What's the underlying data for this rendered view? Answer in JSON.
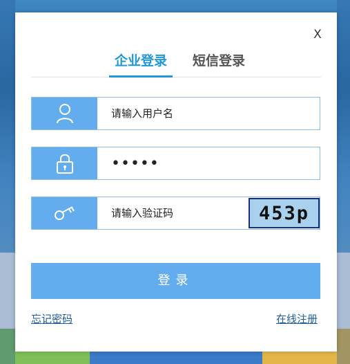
{
  "dialog": {
    "close_label": "X"
  },
  "tabs": [
    {
      "label": "企业登录",
      "active": true
    },
    {
      "label": "短信登录",
      "active": false
    }
  ],
  "form": {
    "username_placeholder": "请输入用户名",
    "password_value": "•••••",
    "captcha_placeholder": "请输入验证码",
    "captcha_code": "453p"
  },
  "login_button": "登录",
  "links": {
    "forgot_password": "忘记密码",
    "register": "在线注册"
  },
  "colors": {
    "accent": "#2196d8",
    "icon_bg": "#63adee",
    "link": "#1e5c99"
  },
  "icons": [
    "user-icon",
    "lock-icon",
    "key-icon",
    "close-icon"
  ]
}
